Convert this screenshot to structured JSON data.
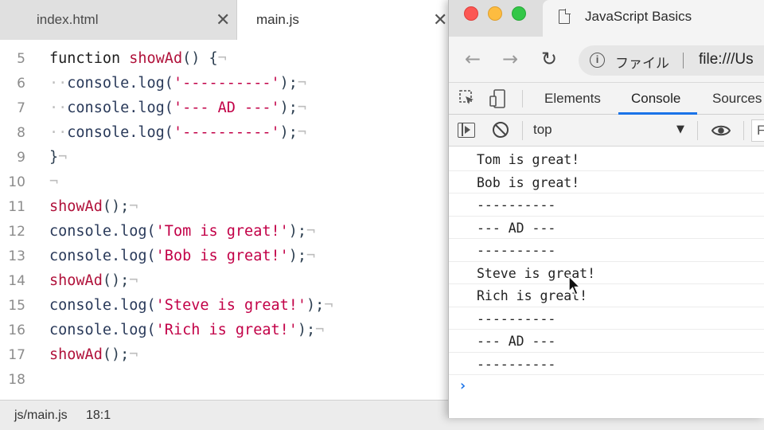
{
  "editor": {
    "tabs": [
      {
        "label": "index.html",
        "close": "✕"
      },
      {
        "label": "main.js",
        "close": "✕"
      }
    ],
    "line_numbers": [
      "5",
      "6",
      "7",
      "8",
      "9",
      "10",
      "11",
      "12",
      "13",
      "14",
      "15",
      "16",
      "17",
      "18"
    ],
    "code": {
      "l5_kw": "function ",
      "l5_fn": "showAd",
      "l5_rest": "() {",
      "indent_marks": "··",
      "console": "console",
      "log_open": ".log(",
      "dashes_str": "'----------'",
      "ad_str": "'--- AD ---'",
      "close": ");",
      "brace_close": "}",
      "showad_call": "showAd",
      "call_rest": "();",
      "tom_str": "'Tom is great!'",
      "bob_str": "'Bob is great!'",
      "steve_str": "'Steve is great!'",
      "rich_str": "'Rich is great!'",
      "eol": "¬"
    },
    "status": {
      "file": "js/main.js",
      "position": "18:1"
    }
  },
  "browser": {
    "tab_title": "JavaScript Basics",
    "nav": {
      "back": "←",
      "forward": "→",
      "reload": "↻"
    },
    "omnibox": {
      "info": "i",
      "label": "ファイル",
      "url": "file:///Us"
    },
    "devtools": {
      "tabs": [
        "Elements",
        "Console",
        "Sources"
      ],
      "active_tab": "Console",
      "context": "top",
      "context_caret": "▼",
      "filter": "F",
      "prompt": "›",
      "accent_color": "#1a73e8",
      "messages": [
        "Tom is great!",
        "Bob is great!",
        "----------",
        "--- AD ---",
        "----------",
        "Steve is great!",
        "Rich is great!",
        "----------",
        "--- AD ---",
        "----------"
      ]
    }
  }
}
